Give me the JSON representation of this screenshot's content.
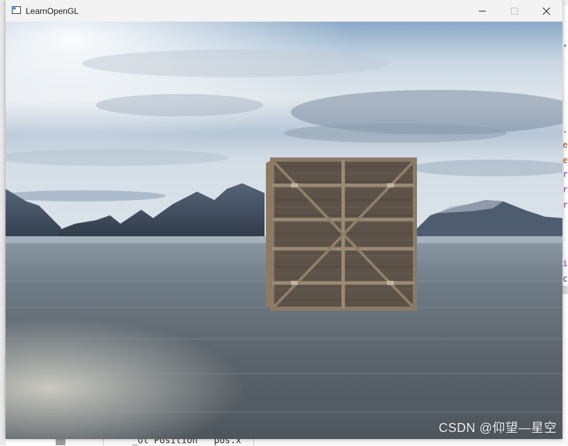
{
  "window": {
    "title": "LearnOpenGL",
    "controls": {
      "minimize": "minimize",
      "maximize": "maximize",
      "close": "close"
    }
  },
  "background_editor": {
    "bottom_text": "_ol Position   pos.x"
  },
  "scene": {
    "skybox": "sky-over-lake-with-mountains",
    "object": "wooden-crate-cube"
  },
  "watermark": "CSDN @仰望—星空",
  "colors": {
    "titlebar": "#f3f3f3",
    "sky_top": "#8fb0cf",
    "water": "#5d6770",
    "crate": "#6e5f50"
  }
}
